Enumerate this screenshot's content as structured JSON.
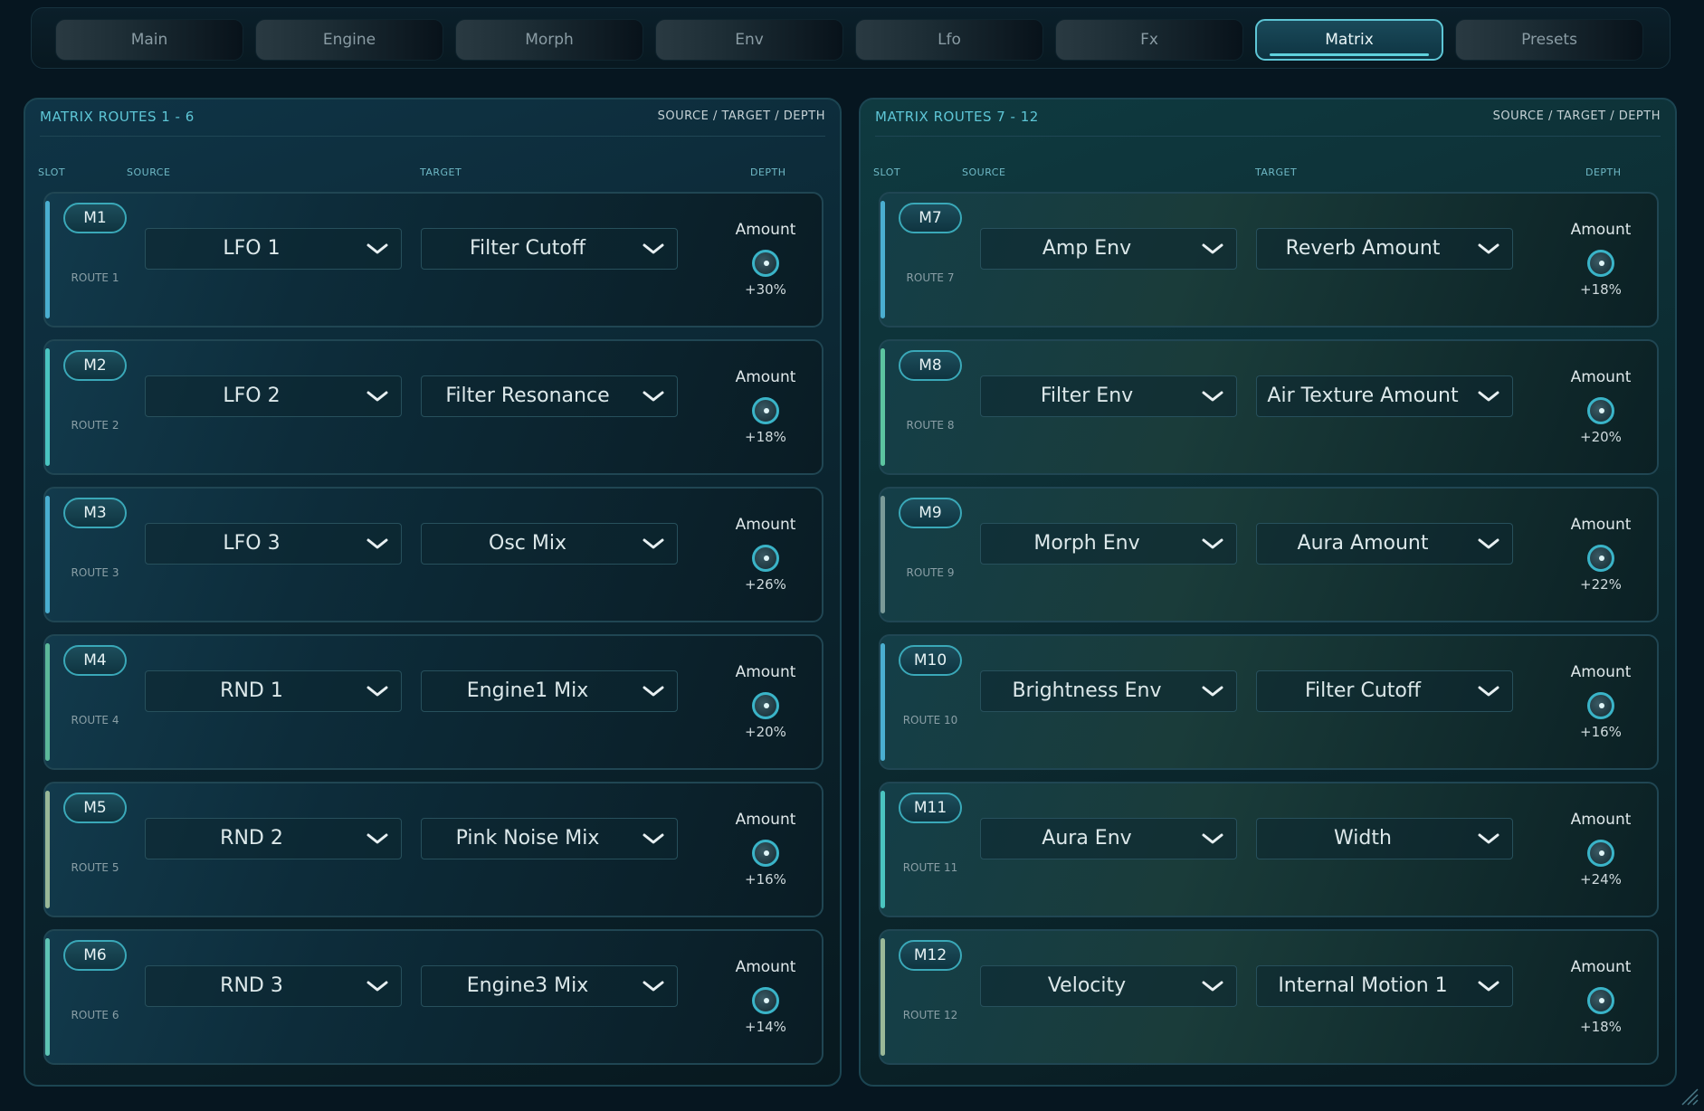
{
  "tabs": [
    {
      "label": "Main"
    },
    {
      "label": "Engine"
    },
    {
      "label": "Morph"
    },
    {
      "label": "Env"
    },
    {
      "label": "Lfo"
    },
    {
      "label": "Fx"
    },
    {
      "label": "Matrix",
      "active": true
    },
    {
      "label": "Presets"
    }
  ],
  "left_panel": {
    "title": "MATRIX ROUTES 1 - 6",
    "subtitle": "SOURCE / TARGET / DEPTH",
    "col_slot": "SLOT",
    "col_source": "SOURCE",
    "col_target": "TARGET",
    "col_depth": "DEPTH",
    "routes": [
      {
        "slot": "M1",
        "route": "ROUTE 1",
        "source": "LFO 1",
        "target": "Filter Cutoff",
        "amount_label": "Amount",
        "amount": "+30%",
        "accent": "#4aaed0"
      },
      {
        "slot": "M2",
        "route": "ROUTE 2",
        "source": "LFO 2",
        "target": "Filter Resonance",
        "amount_label": "Amount",
        "amount": "+18%",
        "accent": "#4ac4c0"
      },
      {
        "slot": "M3",
        "route": "ROUTE 3",
        "source": "LFO 3",
        "target": "Osc Mix",
        "amount_label": "Amount",
        "amount": "+26%",
        "accent": "#4aaed0"
      },
      {
        "slot": "M4",
        "route": "ROUTE 4",
        "source": "RND 1",
        "target": "Engine1 Mix",
        "amount_label": "Amount",
        "amount": "+20%",
        "accent": "#5cb89a"
      },
      {
        "slot": "M5",
        "route": "ROUTE 5",
        "source": "RND 2",
        "target": "Pink Noise Mix",
        "amount_label": "Amount",
        "amount": "+16%",
        "accent": "#9ab898"
      },
      {
        "slot": "M6",
        "route": "ROUTE 6",
        "source": "RND 3",
        "target": "Engine3 Mix",
        "amount_label": "Amount",
        "amount": "+14%",
        "accent": "#5ec4b4"
      }
    ]
  },
  "right_panel": {
    "title": "MATRIX ROUTES 7 - 12",
    "subtitle": "SOURCE / TARGET / DEPTH",
    "col_slot": "SLOT",
    "col_source": "SOURCE",
    "col_target": "TARGET",
    "col_depth": "DEPTH",
    "routes": [
      {
        "slot": "M7",
        "route": "ROUTE 7",
        "source": "Amp Env",
        "target": "Reverb Amount",
        "amount_label": "Amount",
        "amount": "+18%",
        "accent": "#4aaed0"
      },
      {
        "slot": "M8",
        "route": "ROUTE 8",
        "source": "Filter Env",
        "target": "Air Texture Amount",
        "amount_label": "Amount",
        "amount": "+20%",
        "accent": "#5cc4a0"
      },
      {
        "slot": "M9",
        "route": "ROUTE 9",
        "source": "Morph Env",
        "target": "Aura Amount",
        "amount_label": "Amount",
        "amount": "+22%",
        "accent": "#7a9a98"
      },
      {
        "slot": "M10",
        "route": "ROUTE 10",
        "source": "Brightness Env",
        "target": "Filter Cutoff",
        "amount_label": "Amount",
        "amount": "+16%",
        "accent": "#4aaed0"
      },
      {
        "slot": "M11",
        "route": "ROUTE 11",
        "source": "Aura Env",
        "target": "Width",
        "amount_label": "Amount",
        "amount": "+24%",
        "accent": "#4ac4c0"
      },
      {
        "slot": "M12",
        "route": "ROUTE 12",
        "source": "Velocity",
        "target": "Internal Motion 1",
        "amount_label": "Amount",
        "amount": "+18%",
        "accent": "#9ab898"
      }
    ]
  }
}
